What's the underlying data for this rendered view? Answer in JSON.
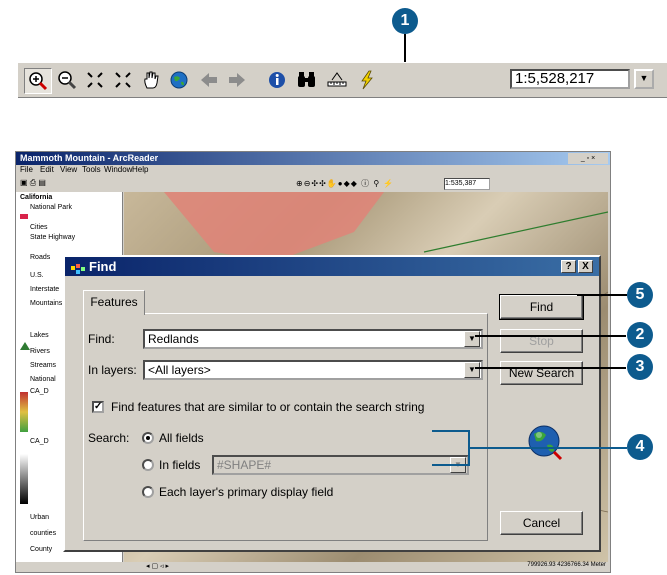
{
  "callouts": [
    "1",
    "2",
    "3",
    "4",
    "5"
  ],
  "toolbar": {
    "tools": [
      {
        "name": "zoom-in-icon",
        "glyph": "⊕",
        "pressed": true
      },
      {
        "name": "zoom-out-icon",
        "glyph": "⊖"
      },
      {
        "name": "fixed-zoom-in-icon",
        "glyph": "⋇"
      },
      {
        "name": "fixed-zoom-out-icon",
        "glyph": "⛶"
      },
      {
        "name": "pan-icon",
        "glyph": "✋"
      },
      {
        "name": "full-extent-icon",
        "glyph": "🌍"
      },
      {
        "name": "back-icon",
        "glyph": "⬅"
      },
      {
        "name": "forward-icon",
        "glyph": "➡"
      },
      {
        "name": "identify-icon",
        "glyph": "ⓘ"
      },
      {
        "name": "find-icon",
        "glyph": "🔭"
      },
      {
        "name": "measure-icon",
        "glyph": "📏"
      },
      {
        "name": "hyperlink-icon",
        "glyph": "⚡"
      }
    ],
    "scale": "1:5,528,217"
  },
  "app": {
    "title": "Mammoth Mountain - ArcReader",
    "menus": [
      "File",
      "Edit",
      "View",
      "Tools",
      "Window",
      "Help"
    ],
    "scale": "1:535,387",
    "toc": [
      "California",
      "National Park",
      "Cities",
      "State Highway",
      "Roads",
      "U.S.",
      "Interstate",
      "Mountains",
      "Lakes",
      "Rivers",
      "Streams",
      "National",
      "CA_D",
      "CA_D",
      "Urban",
      "counties",
      "County"
    ],
    "status": "799926.93 4236766.34 Meter"
  },
  "dialog": {
    "title": "Find",
    "help_btn": "?",
    "close_btn": "X",
    "tab": "Features",
    "find_label": "Find:",
    "find_value": "Redlands",
    "layers_label": "In layers:",
    "layers_value": "<All layers>",
    "similar_label": "Find features that are similar to or contain the search string",
    "search_label": "Search:",
    "all_fields": "All fields",
    "in_fields": "In fields",
    "in_fields_value": "#SHAPE#",
    "primary_field": "Each layer's primary display field",
    "btn_find": "Find",
    "btn_stop": "Stop",
    "btn_new": "New Search",
    "btn_cancel": "Cancel"
  }
}
